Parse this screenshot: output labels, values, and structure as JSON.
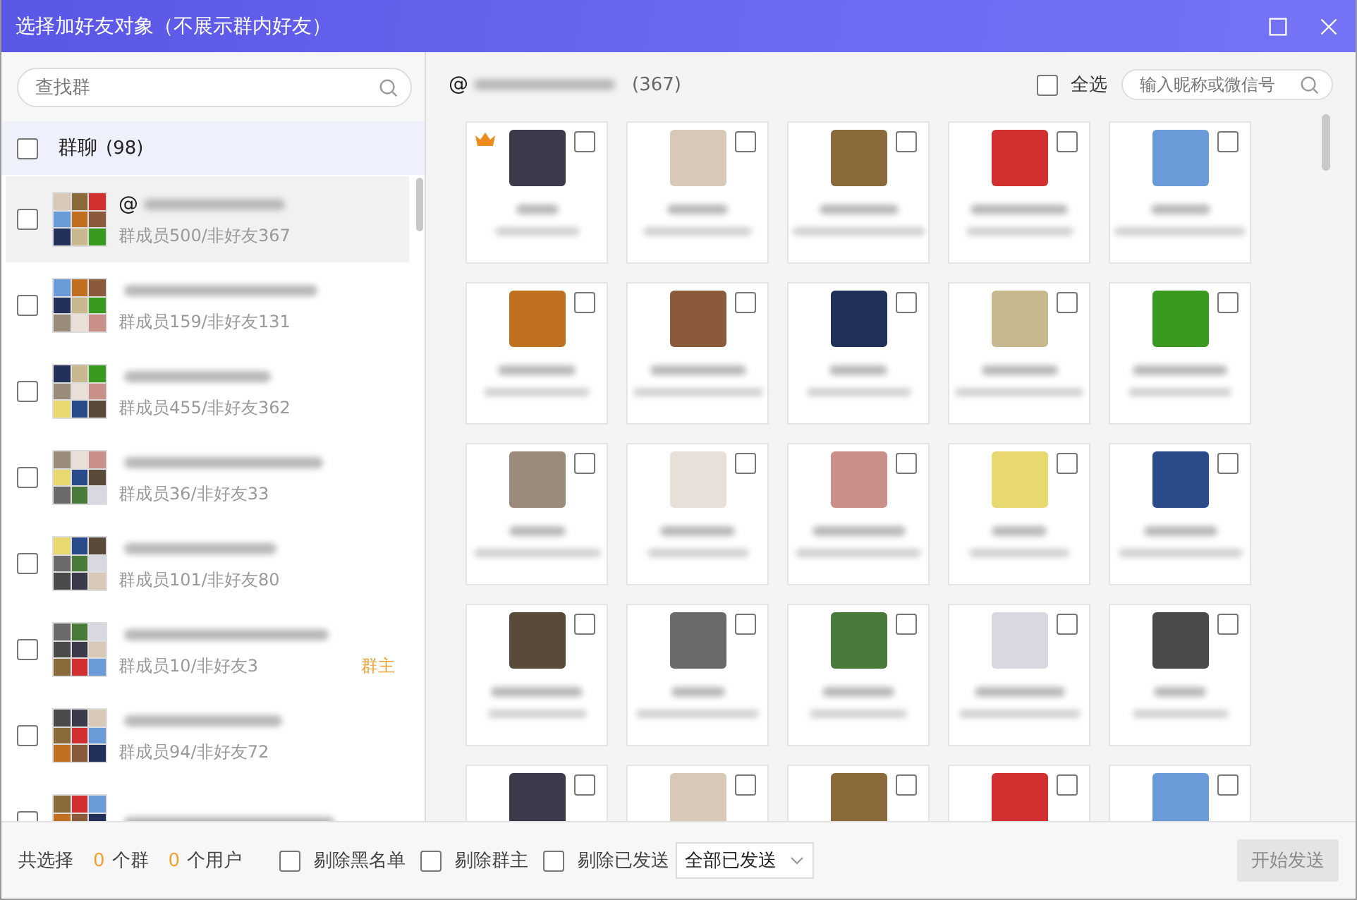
{
  "window": {
    "title": "选择加好友对象（不展示群内好友）"
  },
  "group_search": {
    "placeholder": "查找群"
  },
  "group_list_header": {
    "label": "群聊",
    "count": "(98)",
    "checked": false
  },
  "groups": [
    {
      "name_prefix": "@",
      "stats": "群成员500/非好友367",
      "selected": true,
      "checked": false
    },
    {
      "stats": "群成员159/非好友131",
      "selected": false,
      "checked": false
    },
    {
      "stats": "群成员455/非好友362",
      "selected": false,
      "checked": false
    },
    {
      "stats": "群成员36/非好友33",
      "selected": false,
      "checked": false
    },
    {
      "stats": "群成员101/非好友80",
      "selected": false,
      "checked": false
    },
    {
      "stats": "群成员10/非好友3",
      "selected": false,
      "checked": false,
      "role_label": "群主"
    },
    {
      "stats": "群成员94/非好友72",
      "selected": false,
      "checked": false
    },
    {
      "selected": false,
      "checked": false
    }
  ],
  "member_header": {
    "prefix": "@",
    "count": "(367)"
  },
  "select_all": {
    "label": "全选",
    "checked": false
  },
  "member_search": {
    "placeholder": "输入昵称或微信号"
  },
  "members": [
    {
      "owner": true,
      "checked": false
    },
    {
      "owner": false,
      "checked": false
    },
    {
      "owner": false,
      "checked": false
    },
    {
      "owner": false,
      "checked": false
    },
    {
      "owner": false,
      "checked": false
    },
    {
      "owner": false,
      "checked": false
    },
    {
      "owner": false,
      "checked": false
    },
    {
      "owner": false,
      "checked": false
    },
    {
      "owner": false,
      "checked": false
    },
    {
      "owner": false,
      "checked": false
    },
    {
      "owner": false,
      "checked": false
    },
    {
      "owner": false,
      "checked": false
    },
    {
      "owner": false,
      "checked": false
    },
    {
      "owner": false,
      "checked": false
    },
    {
      "owner": false,
      "checked": false
    },
    {
      "owner": false,
      "checked": false
    },
    {
      "owner": false,
      "checked": false
    },
    {
      "owner": false,
      "checked": false
    },
    {
      "owner": false,
      "checked": false
    },
    {
      "owner": false,
      "checked": false
    },
    {
      "owner": false,
      "checked": false
    },
    {
      "owner": false,
      "checked": false
    },
    {
      "owner": false,
      "checked": false
    },
    {
      "owner": false,
      "checked": false
    },
    {
      "owner": false,
      "checked": false
    }
  ],
  "footer": {
    "summary_label": "共选择",
    "group_count": "0",
    "group_unit": "个群",
    "user_count": "0",
    "user_unit": "个用户",
    "options": [
      {
        "label": "剔除黑名单",
        "checked": false
      },
      {
        "label": "剔除群主",
        "checked": false
      },
      {
        "label": "剔除已发送",
        "checked": false
      }
    ],
    "send_filter": {
      "value": "全部已发送"
    },
    "start_button": {
      "label": "开始发送",
      "disabled": true
    }
  }
}
